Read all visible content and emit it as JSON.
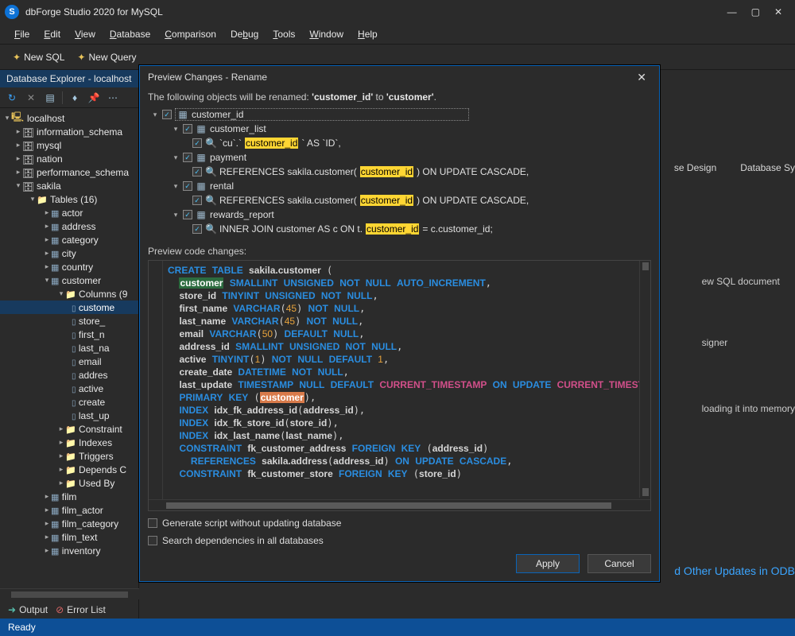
{
  "app": {
    "title": "dbForge Studio 2020 for MySQL"
  },
  "menu": [
    "File",
    "Edit",
    "View",
    "Database",
    "Comparison",
    "Debug",
    "Tools",
    "Window",
    "Help"
  ],
  "toolbar": {
    "newSql": "New SQL",
    "newQuery": "New Query"
  },
  "explorer": {
    "tab": "Database Explorer - localhost",
    "host": "localhost",
    "dbs": [
      "information_schema",
      "mysql",
      "nation",
      "performance_schema"
    ],
    "sakila": "sakila",
    "tablesLabel": "Tables (16)",
    "tables": [
      "actor",
      "address",
      "category",
      "city",
      "country",
      "customer"
    ],
    "columnsLabel": "Columns (9",
    "cols": [
      "custome",
      "store_",
      "first_n",
      "last_na",
      "email",
      "addres",
      "active",
      "create",
      "last_up"
    ],
    "folders": [
      "Constraint",
      "Indexes",
      "Triggers",
      "Depends C",
      "Used By"
    ],
    "moreTables": [
      "film",
      "film_actor",
      "film_category",
      "film_text",
      "inventory"
    ]
  },
  "dialog": {
    "title": "Preview Changes - Rename",
    "msgPrefix": "The following objects will be renamed: ",
    "from": "'customer_id'",
    "to": " to ",
    "toVal": "'customer'",
    "tree": {
      "root": "customer_id",
      "items": [
        {
          "name": "customer_list",
          "ref": "`cu`.`",
          "hl": "customer_id",
          "suffix": "` AS `ID`,"
        },
        {
          "name": "payment",
          "ref": "REFERENCES sakila.customer(",
          "hl": "customer_id",
          "suffix": ") ON UPDATE CASCADE,"
        },
        {
          "name": "rental",
          "ref": "REFERENCES sakila.customer(",
          "hl": "customer_id",
          "suffix": ") ON UPDATE CASCADE,"
        },
        {
          "name": "rewards_report",
          "ref": "INNER JOIN customer AS c ON t.",
          "hl": "customer_id",
          "suffix": " = c.customer_id;"
        }
      ]
    },
    "previewLabel": "Preview code changes:",
    "opt1": "Generate script without updating database",
    "opt2": "Search dependencies in all databases",
    "apply": "Apply",
    "cancel": "Cancel"
  },
  "code": {
    "new1": "customer",
    "new2": "customer"
  },
  "bg": {
    "tabs": [
      "se Design",
      "Database Sy"
    ],
    "hint1": "ew SQL document",
    "hint2": "signer",
    "hint3": "loading it into memory",
    "link": "d Other Updates in ODB"
  },
  "bottom": {
    "output": "Output",
    "errors": "Error List"
  },
  "status": "Ready"
}
